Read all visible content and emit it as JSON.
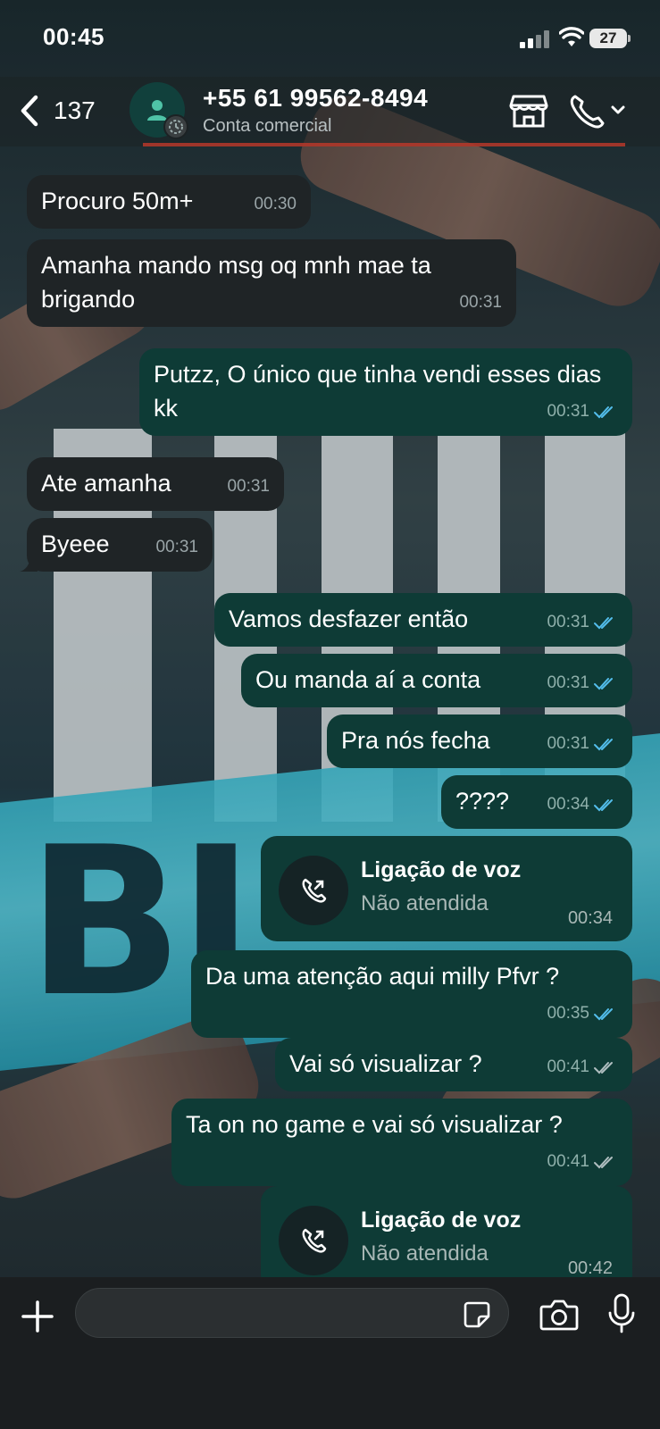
{
  "status_bar": {
    "time": "00:45",
    "battery": "27"
  },
  "header": {
    "unread_count": "137",
    "contact_name": "+55 61 99562-8494",
    "contact_subtitle": "Conta comercial"
  },
  "messages": [
    {
      "dir": "in",
      "text": "Procuro 50m+",
      "time": "00:30"
    },
    {
      "dir": "in",
      "text": "Amanha mando msg oq mnh mae ta brigando",
      "time": "00:31"
    },
    {
      "dir": "out",
      "text": "Putzz, O único que tinha vendi esses dias kk",
      "time": "00:31"
    },
    {
      "dir": "in",
      "text": "Ate amanha",
      "time": "00:31"
    },
    {
      "dir": "in",
      "text": "Byeee",
      "time": "00:31"
    },
    {
      "dir": "out",
      "text": "Vamos desfazer então",
      "time": "00:31"
    },
    {
      "dir": "out",
      "text": "Ou manda aí a conta",
      "time": "00:31"
    },
    {
      "dir": "out",
      "text": "Pra nós fecha",
      "time": "00:31"
    },
    {
      "dir": "out",
      "text": "????",
      "time": "00:34"
    },
    {
      "dir": "out",
      "text": "Da uma atenção aqui milly Pfvr ?",
      "time": "00:35"
    },
    {
      "dir": "out",
      "text": "Vai só visualizar ?",
      "time": "00:41"
    },
    {
      "dir": "out",
      "text": "Ta on no game e vai só visualizar ?",
      "time": "00:41"
    }
  ],
  "calls": [
    {
      "title": "Ligação de voz",
      "status": "Não atendida",
      "time": "00:34"
    },
    {
      "title": "Ligação de voz",
      "status": "Não atendida",
      "time": "00:42"
    }
  ],
  "colors": {
    "incoming_bubble": "#1f2426",
    "outgoing_bubble": "#0e3b36",
    "read_ticks": "#53bdeb"
  },
  "icons": [
    "back-icon",
    "person-icon",
    "store-icon",
    "phone-icon",
    "chevron-down-icon",
    "plus-icon",
    "sticker-icon",
    "camera-icon",
    "mic-icon"
  ]
}
